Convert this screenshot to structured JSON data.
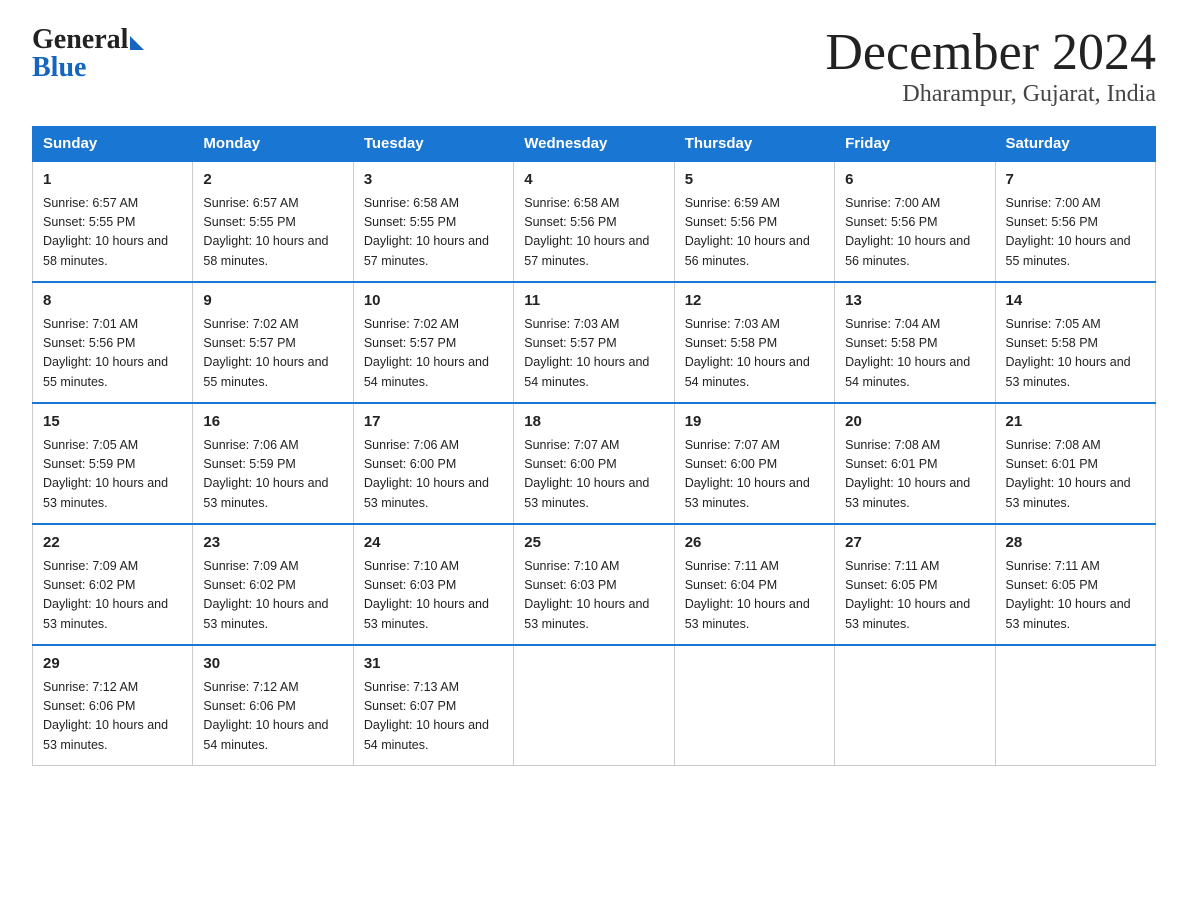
{
  "header": {
    "logo_general": "General",
    "logo_blue": "Blue",
    "title": "December 2024",
    "subtitle": "Dharampur, Gujarat, India"
  },
  "calendar": {
    "days_of_week": [
      "Sunday",
      "Monday",
      "Tuesday",
      "Wednesday",
      "Thursday",
      "Friday",
      "Saturday"
    ],
    "weeks": [
      [
        {
          "date": "1",
          "sunrise": "6:57 AM",
          "sunset": "5:55 PM",
          "daylight": "10 hours and 58 minutes."
        },
        {
          "date": "2",
          "sunrise": "6:57 AM",
          "sunset": "5:55 PM",
          "daylight": "10 hours and 58 minutes."
        },
        {
          "date": "3",
          "sunrise": "6:58 AM",
          "sunset": "5:55 PM",
          "daylight": "10 hours and 57 minutes."
        },
        {
          "date": "4",
          "sunrise": "6:58 AM",
          "sunset": "5:56 PM",
          "daylight": "10 hours and 57 minutes."
        },
        {
          "date": "5",
          "sunrise": "6:59 AM",
          "sunset": "5:56 PM",
          "daylight": "10 hours and 56 minutes."
        },
        {
          "date": "6",
          "sunrise": "7:00 AM",
          "sunset": "5:56 PM",
          "daylight": "10 hours and 56 minutes."
        },
        {
          "date": "7",
          "sunrise": "7:00 AM",
          "sunset": "5:56 PM",
          "daylight": "10 hours and 55 minutes."
        }
      ],
      [
        {
          "date": "8",
          "sunrise": "7:01 AM",
          "sunset": "5:56 PM",
          "daylight": "10 hours and 55 minutes."
        },
        {
          "date": "9",
          "sunrise": "7:02 AM",
          "sunset": "5:57 PM",
          "daylight": "10 hours and 55 minutes."
        },
        {
          "date": "10",
          "sunrise": "7:02 AM",
          "sunset": "5:57 PM",
          "daylight": "10 hours and 54 minutes."
        },
        {
          "date": "11",
          "sunrise": "7:03 AM",
          "sunset": "5:57 PM",
          "daylight": "10 hours and 54 minutes."
        },
        {
          "date": "12",
          "sunrise": "7:03 AM",
          "sunset": "5:58 PM",
          "daylight": "10 hours and 54 minutes."
        },
        {
          "date": "13",
          "sunrise": "7:04 AM",
          "sunset": "5:58 PM",
          "daylight": "10 hours and 54 minutes."
        },
        {
          "date": "14",
          "sunrise": "7:05 AM",
          "sunset": "5:58 PM",
          "daylight": "10 hours and 53 minutes."
        }
      ],
      [
        {
          "date": "15",
          "sunrise": "7:05 AM",
          "sunset": "5:59 PM",
          "daylight": "10 hours and 53 minutes."
        },
        {
          "date": "16",
          "sunrise": "7:06 AM",
          "sunset": "5:59 PM",
          "daylight": "10 hours and 53 minutes."
        },
        {
          "date": "17",
          "sunrise": "7:06 AM",
          "sunset": "6:00 PM",
          "daylight": "10 hours and 53 minutes."
        },
        {
          "date": "18",
          "sunrise": "7:07 AM",
          "sunset": "6:00 PM",
          "daylight": "10 hours and 53 minutes."
        },
        {
          "date": "19",
          "sunrise": "7:07 AM",
          "sunset": "6:00 PM",
          "daylight": "10 hours and 53 minutes."
        },
        {
          "date": "20",
          "sunrise": "7:08 AM",
          "sunset": "6:01 PM",
          "daylight": "10 hours and 53 minutes."
        },
        {
          "date": "21",
          "sunrise": "7:08 AM",
          "sunset": "6:01 PM",
          "daylight": "10 hours and 53 minutes."
        }
      ],
      [
        {
          "date": "22",
          "sunrise": "7:09 AM",
          "sunset": "6:02 PM",
          "daylight": "10 hours and 53 minutes."
        },
        {
          "date": "23",
          "sunrise": "7:09 AM",
          "sunset": "6:02 PM",
          "daylight": "10 hours and 53 minutes."
        },
        {
          "date": "24",
          "sunrise": "7:10 AM",
          "sunset": "6:03 PM",
          "daylight": "10 hours and 53 minutes."
        },
        {
          "date": "25",
          "sunrise": "7:10 AM",
          "sunset": "6:03 PM",
          "daylight": "10 hours and 53 minutes."
        },
        {
          "date": "26",
          "sunrise": "7:11 AM",
          "sunset": "6:04 PM",
          "daylight": "10 hours and 53 minutes."
        },
        {
          "date": "27",
          "sunrise": "7:11 AM",
          "sunset": "6:05 PM",
          "daylight": "10 hours and 53 minutes."
        },
        {
          "date": "28",
          "sunrise": "7:11 AM",
          "sunset": "6:05 PM",
          "daylight": "10 hours and 53 minutes."
        }
      ],
      [
        {
          "date": "29",
          "sunrise": "7:12 AM",
          "sunset": "6:06 PM",
          "daylight": "10 hours and 53 minutes."
        },
        {
          "date": "30",
          "sunrise": "7:12 AM",
          "sunset": "6:06 PM",
          "daylight": "10 hours and 54 minutes."
        },
        {
          "date": "31",
          "sunrise": "7:13 AM",
          "sunset": "6:07 PM",
          "daylight": "10 hours and 54 minutes."
        },
        null,
        null,
        null,
        null
      ]
    ]
  }
}
